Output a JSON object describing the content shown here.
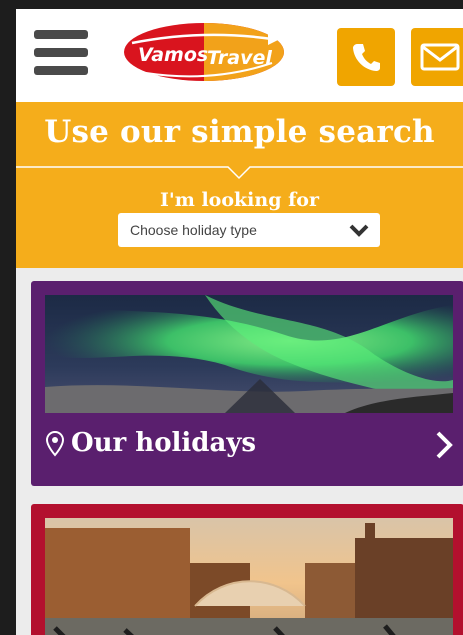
{
  "header": {
    "logo_text_1": "Vamos",
    "logo_text_2": "Travel",
    "menu_icon": "hamburger-icon",
    "phone_icon": "phone-icon",
    "mail_icon": "mail-icon",
    "accent_color": "#f0a500"
  },
  "search": {
    "title": "Use our simple search",
    "label": "I'm looking for",
    "select_value": "Choose holiday type",
    "background_color": "#f5ad1b"
  },
  "cards": [
    {
      "title": "Our holidays",
      "icon": "map-pin-icon",
      "chevron_icon": "chevron-right-icon",
      "background_color": "#5a1f6e"
    },
    {
      "background_color": "#b3102e"
    }
  ]
}
